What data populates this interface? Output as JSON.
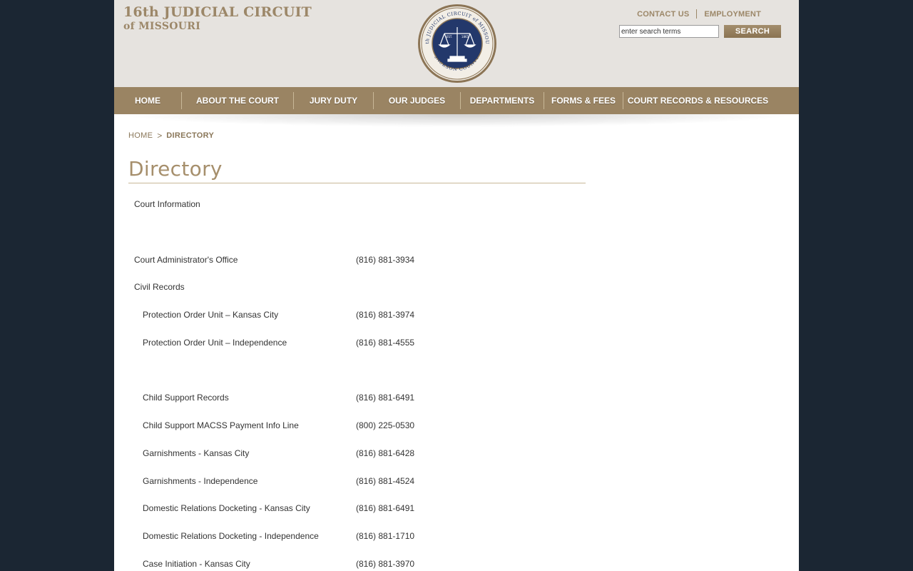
{
  "header": {
    "title_line1": "16th JUDICIAL CIRCUIT",
    "title_line2": "of MISSOURI",
    "seal_text_top": "16th JUDICIAL CIRCUIT of MISSOURI",
    "seal_text_bottom": "JACKSON COUNTY",
    "seal_est": "EST.",
    "seal_year": "1865",
    "utility_links": [
      "CONTACT US",
      "EMPLOYMENT"
    ],
    "search_placeholder": "enter search terms",
    "search_button": "SEARCH"
  },
  "nav": {
    "items": [
      "HOME",
      "ABOUT THE COURT",
      "JURY DUTY",
      "OUR JUDGES",
      "DEPARTMENTS",
      "FORMS & FEES",
      "COURT RECORDS & RESOURCES"
    ]
  },
  "breadcrumb": {
    "home": "HOME",
    "separator": ">",
    "current": "DIRECTORY"
  },
  "page_title": "Directory",
  "directory": [
    {
      "label": "Court Information",
      "phone": ""
    },
    {
      "label": "Court Administrator's Office",
      "phone": "(816) 881-3934"
    },
    {
      "label": "Civil Records",
      "phone": ""
    },
    {
      "label": "Protection Order Unit – Kansas City",
      "phone": "(816) 881-3974"
    },
    {
      "label": "Protection Order Unit – Independence",
      "phone": "(816) 881-4555"
    },
    {
      "label": "Child Support Records",
      "phone": "(816) 881-6491"
    },
    {
      "label": "Child Support MACSS Payment Info Line",
      "phone": "(800) 225-0530"
    },
    {
      "label": "Garnishments - Kansas City",
      "phone": "(816) 881-6428"
    },
    {
      "label": "Garnishments - Independence",
      "phone": "(816) 881-4524"
    },
    {
      "label": "Domestic Relations Docketing - Kansas City",
      "phone": "(816) 881-6491"
    },
    {
      "label": "Domestic Relations Docketing - Independence",
      "phone": "(816) 881-1710"
    },
    {
      "label": "Case Initiation - Kansas City",
      "phone": "(816) 881-3970"
    }
  ],
  "colors": {
    "brand_tan": "#9a8463",
    "header_bg": "#e6e3df",
    "page_bg": "#1b2633",
    "seal_navy": "#23386b"
  }
}
